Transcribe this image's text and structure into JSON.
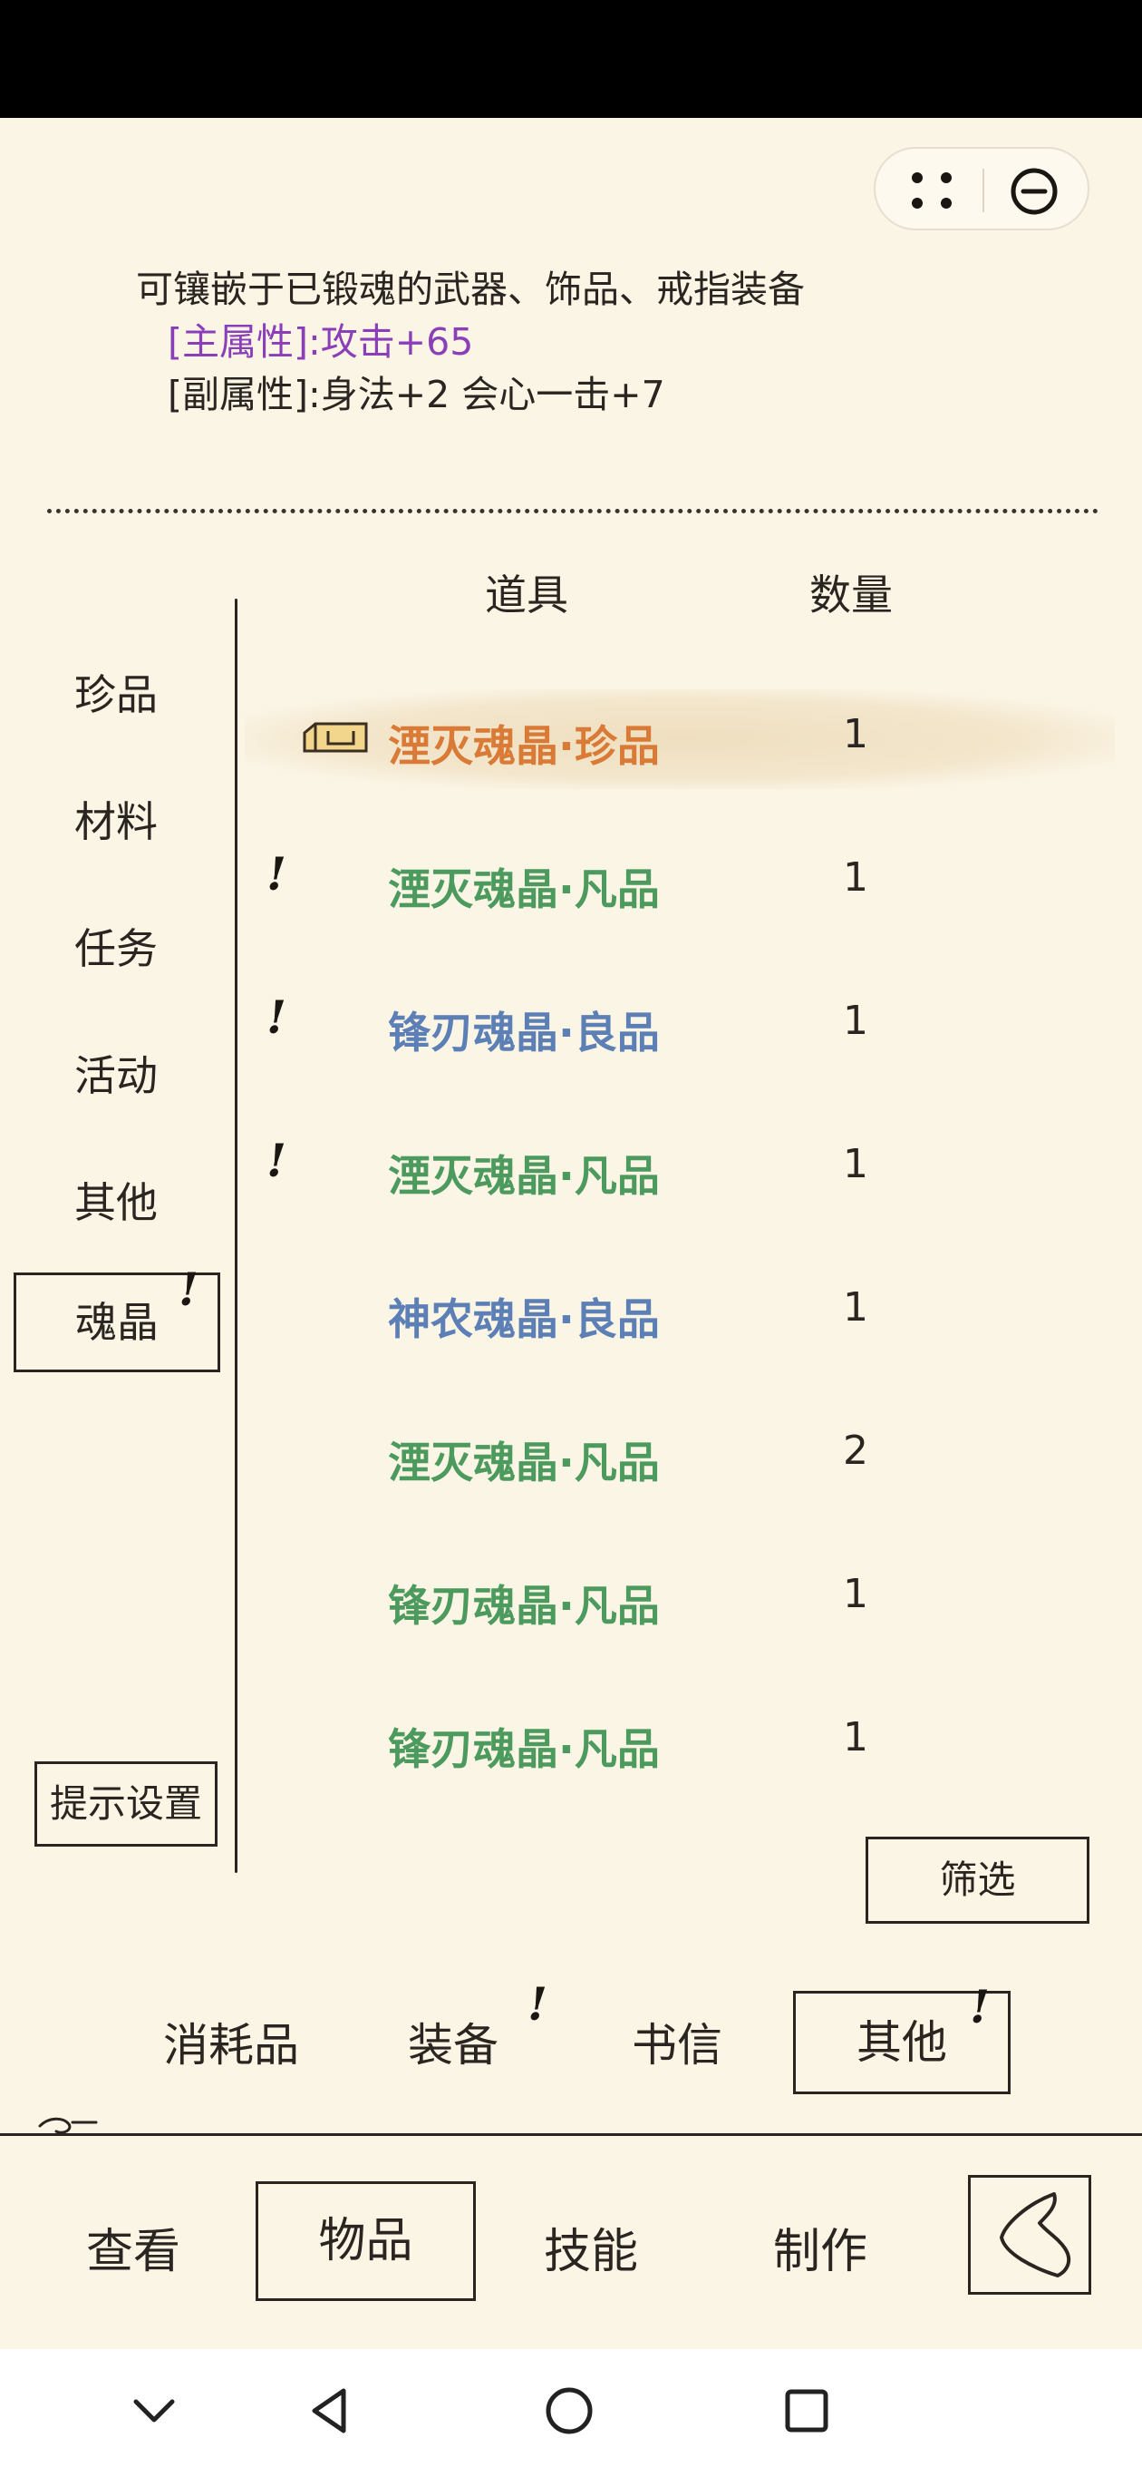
{
  "description": {
    "line1": "可镶嵌于已锻魂的武器、饰品、戒指装备",
    "main_attr": "[主属性]:攻击+65",
    "sub_attr": "[副属性]:身法+2 会心一击+7"
  },
  "columns": {
    "item": "道具",
    "quantity": "数量"
  },
  "sidebar": {
    "items": [
      {
        "label": "珍品"
      },
      {
        "label": "材料"
      },
      {
        "label": "任务"
      },
      {
        "label": "活动"
      },
      {
        "label": "其他"
      },
      {
        "label": "魂晶",
        "active": true,
        "alert": "!"
      }
    ],
    "tip_settings": "提示设置"
  },
  "items": [
    {
      "name": "湮灭魂晶·珍品",
      "qty": "1",
      "color": "#d97a36",
      "selected": true
    },
    {
      "name": "湮灭魂晶·凡品",
      "qty": "1",
      "color": "#4c9a5e",
      "alert": "!"
    },
    {
      "name": "锋刃魂晶·良品",
      "qty": "1",
      "color": "#5c80b6",
      "alert": "!"
    },
    {
      "name": "湮灭魂晶·凡品",
      "qty": "1",
      "color": "#4c9a5e",
      "alert": "!"
    },
    {
      "name": "神农魂晶·良品",
      "qty": "1",
      "color": "#5c80b6"
    },
    {
      "name": "湮灭魂晶·凡品",
      "qty": "2",
      "color": "#4c9a5e"
    },
    {
      "name": "锋刃魂晶·凡品",
      "qty": "1",
      "color": "#4c9a5e"
    },
    {
      "name": "锋刃魂晶·凡品",
      "qty": "1",
      "color": "#4c9a5e"
    }
  ],
  "filter": "筛选",
  "category_tabs": [
    {
      "label": "消耗品"
    },
    {
      "label": "装备",
      "alert": "!"
    },
    {
      "label": "书信"
    },
    {
      "label": "其他",
      "active": true,
      "alert": "!"
    }
  ],
  "bottom_nav": [
    {
      "label": "查看"
    },
    {
      "label": "物品",
      "active": true
    },
    {
      "label": "技能"
    },
    {
      "label": "制作"
    }
  ],
  "icons": {
    "more": "more-dots-icon",
    "minimize": "minimize-icon",
    "box": "box-icon",
    "back": "back-arrow-icon",
    "sys_down": "chevron-down-icon",
    "sys_back": "triangle-back-icon",
    "sys_home": "circle-home-icon",
    "sys_recent": "square-recent-icon"
  }
}
